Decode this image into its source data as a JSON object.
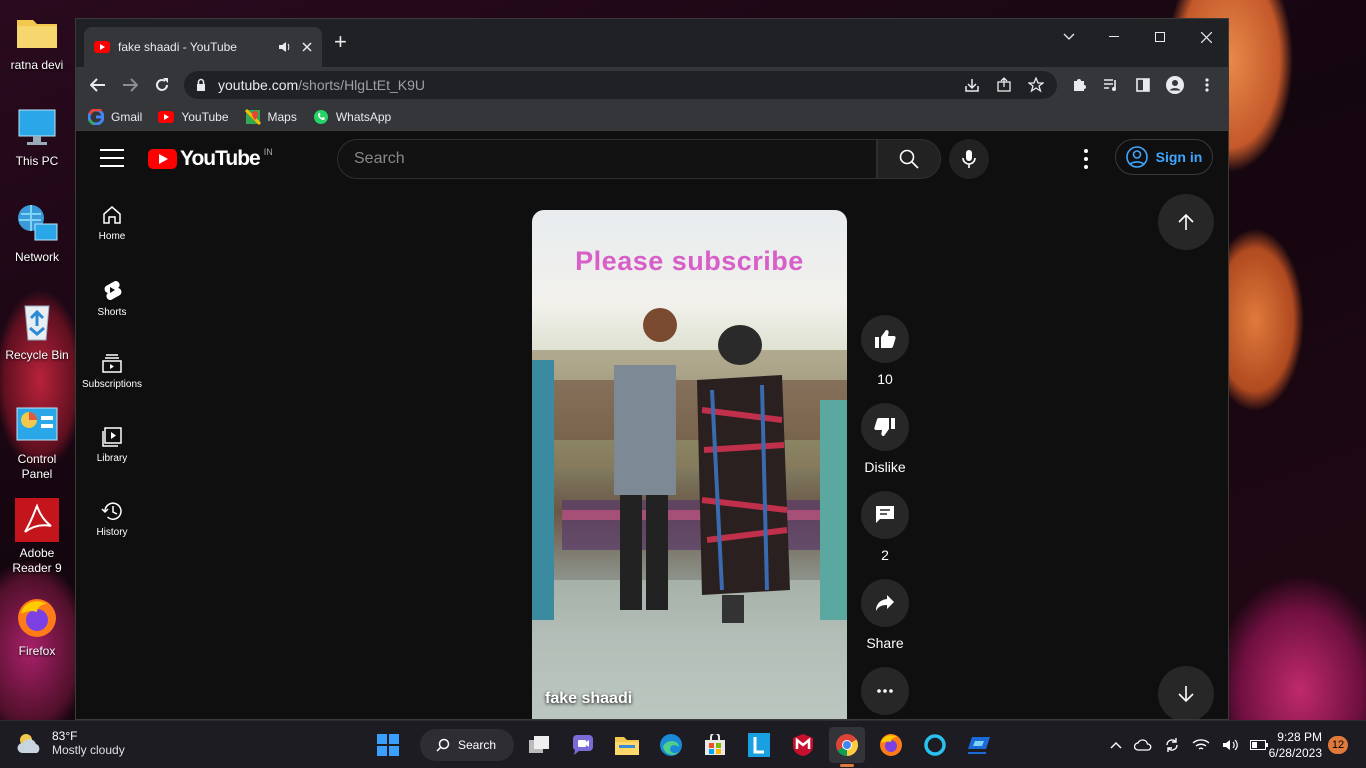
{
  "desktop": {
    "icons": [
      {
        "label": "ratna devi"
      },
      {
        "label": "This PC"
      },
      {
        "label": "Network"
      },
      {
        "label": "Recycle Bin"
      },
      {
        "label": "Control Panel"
      },
      {
        "label": "Adobe Reader 9"
      },
      {
        "label": "Firefox"
      }
    ]
  },
  "browser": {
    "tab_title": "fake shaadi - YouTube",
    "url_host": "youtube.com",
    "url_path": "/shorts/HlgLtEt_K9U",
    "bookmarks": [
      {
        "label": "Gmail"
      },
      {
        "label": "YouTube"
      },
      {
        "label": "Maps"
      },
      {
        "label": "WhatsApp"
      }
    ]
  },
  "youtube": {
    "logo_text": "YouTube",
    "country_code": "IN",
    "search_placeholder": "Search",
    "signin_label": "Sign in",
    "guide": [
      {
        "label": "Home"
      },
      {
        "label": "Shorts"
      },
      {
        "label": "Subscriptions"
      },
      {
        "label": "Library"
      },
      {
        "label": "History"
      }
    ],
    "short": {
      "overlay_text": "Please subscribe",
      "title": "fake shaadi"
    },
    "actions": {
      "like_count": "10",
      "dislike_label": "Dislike",
      "comment_count": "2",
      "share_label": "Share"
    }
  },
  "taskbar": {
    "weather_temp": "83°F",
    "weather_desc": "Mostly cloudy",
    "search_label": "Search",
    "time": "9:28 PM",
    "date": "6/28/2023",
    "notifications": "12"
  }
}
